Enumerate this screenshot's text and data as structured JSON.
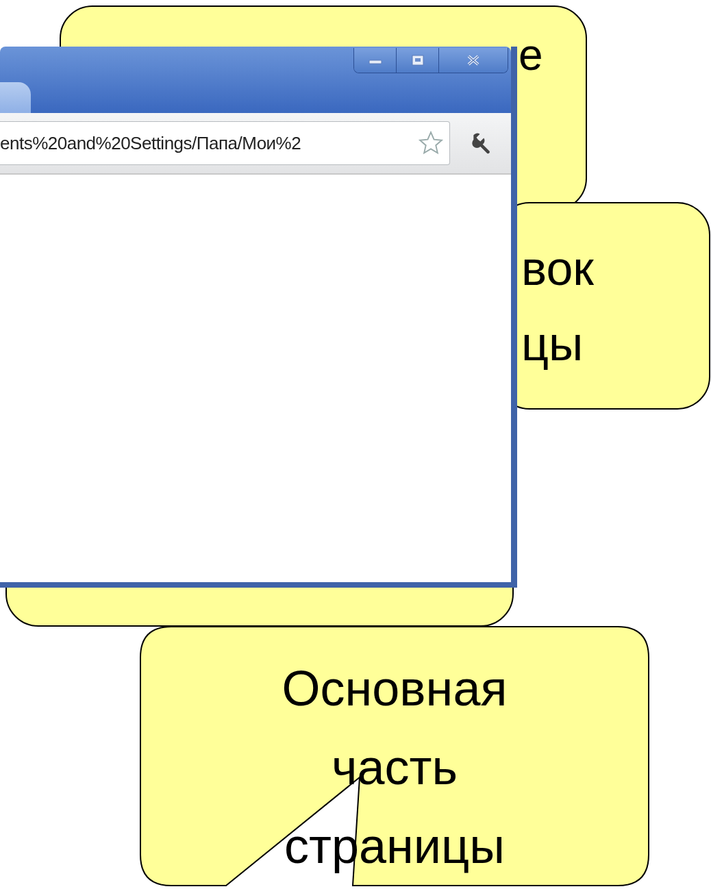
{
  "browser": {
    "address": "ents%20and%20Settings/Папа/Мои%2"
  },
  "callouts": [
    {
      "kind": "top",
      "lines": [
        "е"
      ]
    },
    {
      "kind": "right",
      "lines": [
        "вок",
        "цы"
      ]
    },
    {
      "kind": "bottom"
    },
    {
      "kind": "main",
      "lines": [
        "Основная",
        "часть",
        "страницы"
      ]
    }
  ]
}
